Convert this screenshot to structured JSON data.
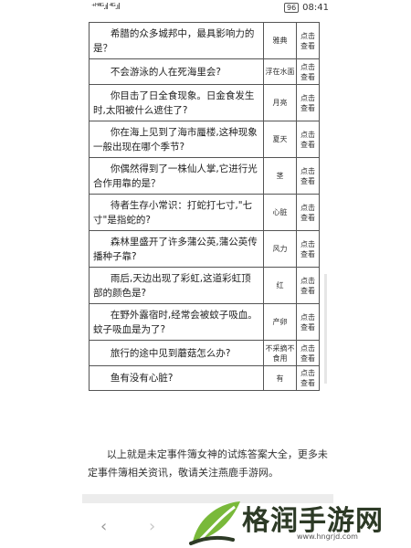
{
  "status_bar": {
    "left_icons": "⁺ᴴ⁴ᴳ.ıl ⁴ᴳ.ıl",
    "battery": "96",
    "time": "08:41"
  },
  "top_partial": "该部分内容较长",
  "rows": [
    {
      "q": "希腊的众多城邦中，最具影响力的是？",
      "a": "雅典",
      "btn1": "点击",
      "btn2": "查看"
    },
    {
      "q": "不会游泳的人在死海里会?",
      "a": "浮在水面",
      "btn1": "点击",
      "btn2": "查看"
    },
    {
      "q": "你目击了日全食现象。日金食发生时,太阳被什么遮住了?",
      "a": "月亮",
      "btn1": "点击",
      "btn2": "查看"
    },
    {
      "q": "你在海上见到了海市蜃楼,这种现象一般出现在哪个季节?",
      "a": "夏天",
      "btn1": "点击",
      "btn2": "查看"
    },
    {
      "q": "你偶然得到了一株仙人掌,它进行光合作用靠的是？",
      "a": "茎",
      "btn1": "点击",
      "btn2": "查看"
    },
    {
      "q": "待者生存小常识：打蛇打七寸,\"七寸\"是指蛇的?",
      "a": "心脏",
      "btn1": "点击",
      "btn2": "查看"
    },
    {
      "q": "森林里盛开了许多蒲公英,蒲公英传播种子靠?",
      "a": "风力",
      "btn1": "点击",
      "btn2": "查看"
    },
    {
      "q": "雨后,天边出现了彩虹,这道彩虹顶部的颜色是?",
      "a": "红",
      "btn1": "点击",
      "btn2": "查看"
    },
    {
      "q": "在野外露宿时,经常会被蚊子吸血。蚊子吸血是为了?",
      "a": "产卵",
      "btn1": "点击",
      "btn2": "查看"
    },
    {
      "q": "旅行的途中见到蘑菇怎么办?",
      "a": "不采摘不食用",
      "btn1": "点击",
      "btn2": "查看"
    },
    {
      "q": "鱼有没有心脏?",
      "a": "有",
      "btn1": "点击",
      "btn2": "查看"
    }
  ],
  "footer": "以上就是未定事件簿女神的试炼答案大全，更多未定事件簿相关资讯，敬请关注燕鹿手游网。",
  "nav": {
    "back": "‹",
    "forward": "›"
  },
  "watermark": {
    "title": "格润手游网",
    "url": "www.hngrjd.com"
  },
  "colors": {
    "border": "#555555",
    "logo_green": "#79b93a",
    "logo_text": "#2d3a26"
  }
}
